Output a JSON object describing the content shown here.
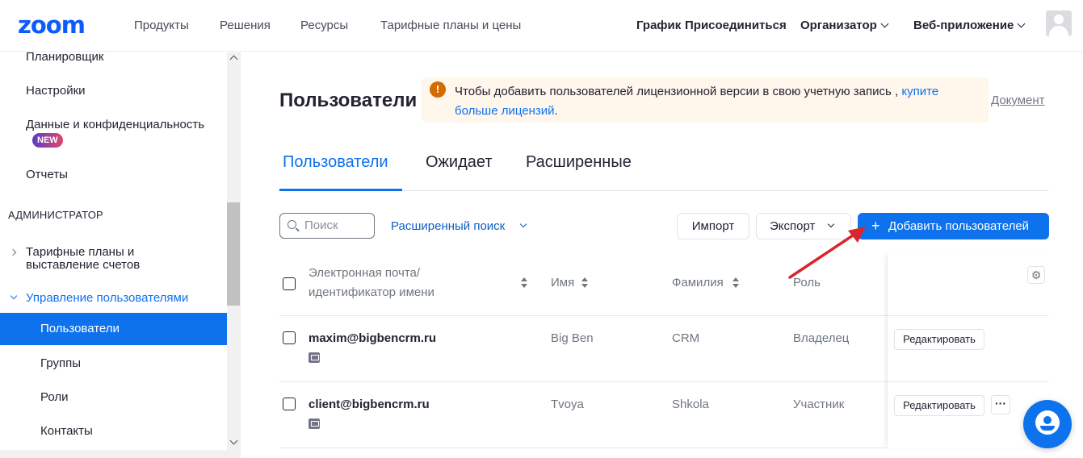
{
  "header": {
    "logo": "zoom",
    "nav": [
      "Продукты",
      "Решения",
      "Ресурсы",
      "Тарифные планы и цены"
    ],
    "right": {
      "schedule": "График",
      "join": "Присоединиться",
      "host": "Организатор",
      "web_app": "Веб-приложение"
    }
  },
  "sidebar": {
    "items_top": [
      "Планировщик",
      "Настройки",
      "Данные и конфиденциальность",
      "Отчеты"
    ],
    "new_badge": "NEW",
    "section_admin": "АДМИНИСТРАТОР",
    "billing": "Тарифные планы и выставление счетов",
    "user_mgmt": "Управление пользователями",
    "sub_items": [
      "Пользователи",
      "Группы",
      "Роли",
      "Контакты"
    ],
    "active_item": "Пользователи"
  },
  "main": {
    "title": "Пользователи",
    "notice": {
      "text": "Чтобы добавить пользователей лицензионной версии в свою учетную запись ,",
      "link": "купите больше лицензий",
      "end": "."
    },
    "doc_link": "Документ",
    "tabs": [
      "Пользователи",
      "Ожидает",
      "Расширенные"
    ],
    "active_tab": "Пользователи",
    "search_placeholder": "Поиск",
    "advanced_search": "Расширенный поиск",
    "import_label": "Импорт",
    "export_label": "Экспорт",
    "add_users_label": "Добавить пользователей",
    "columns": {
      "email": "Электронная почта/ идентификатор имени",
      "first_name": "Имя",
      "last_name": "Фамилия",
      "role": "Роль"
    },
    "rows": [
      {
        "email": "maxim@bigbencrm.ru",
        "first_name": "Big Ben",
        "last_name": "CRM",
        "role": "Владелец",
        "edit": "Редактировать"
      },
      {
        "email": "client@bigbencrm.ru",
        "first_name": "Tvoya",
        "last_name": "Shkola",
        "role": "Участник",
        "edit": "Редактировать",
        "more": "···"
      }
    ]
  },
  "colors": {
    "brand": "#0b5cff",
    "accent": "#0e72ed",
    "warning": "#d36b00",
    "notice_bg": "#fff6ec",
    "annotation_arrow": "#d9262c"
  }
}
